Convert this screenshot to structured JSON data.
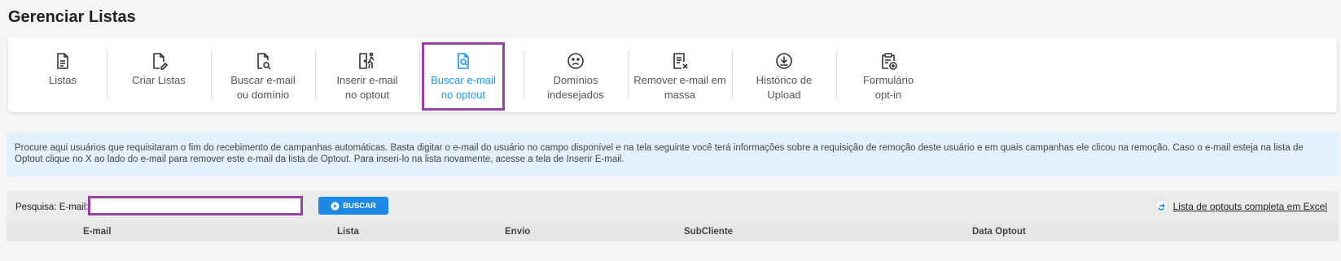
{
  "page": {
    "title": "Gerenciar Listas"
  },
  "nav": {
    "items": [
      {
        "icon": "document-list-icon",
        "line1": "Listas",
        "line2": ""
      },
      {
        "icon": "document-edit-icon",
        "line1": "Criar Listas",
        "line2": ""
      },
      {
        "icon": "document-search-icon",
        "line1": "Buscar e-mail",
        "line2": "ou domínio"
      },
      {
        "icon": "exit-door-person-icon",
        "line1": "Inserir e-mail",
        "line2": "no optout"
      },
      {
        "icon": "search-document-icon",
        "line1": "Buscar e-mail",
        "line2": "no optout"
      },
      {
        "icon": "sad-face-icon",
        "line1": "Domínios",
        "line2": "indesejados"
      },
      {
        "icon": "remove-document-icon",
        "line1": "Remover e-mail em",
        "line2": "massa"
      },
      {
        "icon": "download-circle-icon",
        "line1": "Histórico de",
        "line2": "Upload"
      },
      {
        "icon": "clipboard-add-icon",
        "line1": "Formulário",
        "line2": "opt-in"
      }
    ],
    "active_index": 4
  },
  "info": {
    "text": "Procure aqui usuários que requisitaram o fim do recebimento de campanhas automáticas. Basta digitar o e-mail do usuário no campo disponível e na tela seguinte você terá informações sobre a requisição de remoção deste usuário e em quais campanhas ele clicou na remoção. Caso o e-mail esteja na lista de Optout clique no X ao lado do e-mail para remover este e-mail da lista de Optout. Para inseri-lo na lista novamente, acesse a tela de Inserir E-mail."
  },
  "search": {
    "label": "Pesquisa: E-mail:",
    "value": "",
    "button_label": "BUSCAR",
    "excel_link": "Lista de optouts completa em Excel"
  },
  "table": {
    "columns": [
      "E-mail",
      "Lista",
      "Envio",
      "SubCliente",
      "Data Optout"
    ]
  },
  "colors": {
    "accent": "#2196f3",
    "highlight_border": "#9b3fa8",
    "info_bg": "#e3f0fd",
    "button_bg": "#1e88e5"
  }
}
